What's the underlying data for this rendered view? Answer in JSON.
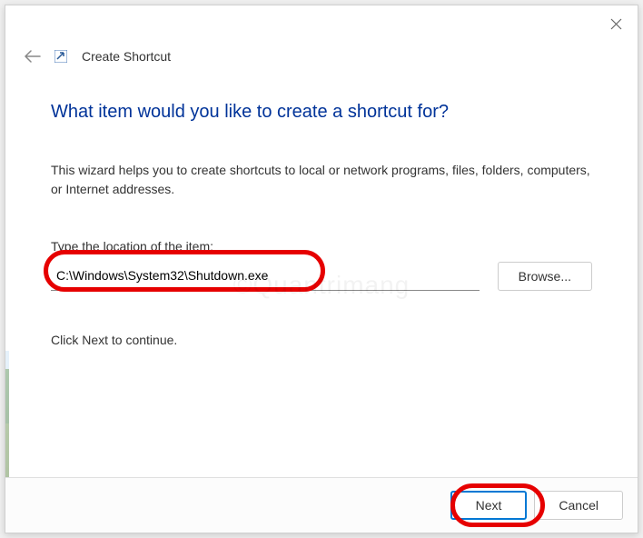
{
  "header": {
    "title": "Create Shortcut"
  },
  "content": {
    "heading": "What item would you like to create a shortcut for?",
    "description": "This wizard helps you to create shortcuts to local or network programs, files, folders, computers, or Internet addresses.",
    "input_label": "Type the location of the item:",
    "input_value": "C:\\Windows\\System32\\Shutdown.exe",
    "browse_label": "Browse...",
    "continue_text": "Click Next to continue."
  },
  "footer": {
    "next_label": "Next",
    "cancel_label": "Cancel"
  },
  "watermark": "©Quantrimang"
}
